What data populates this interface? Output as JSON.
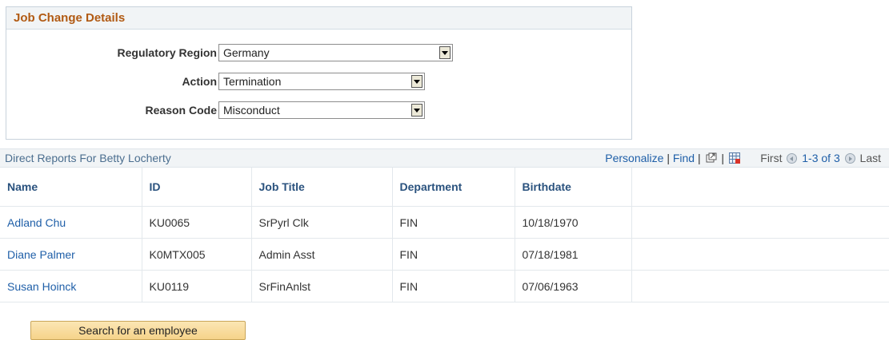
{
  "panel": {
    "title": "Job Change Details",
    "fields": [
      {
        "label": "Regulatory Region",
        "value": "Germany"
      },
      {
        "label": "Action",
        "value": "Termination"
      },
      {
        "label": "Reason Code",
        "value": "Misconduct"
      }
    ]
  },
  "grid": {
    "caption": "Direct Reports For Betty Locherty",
    "personalize": "Personalize",
    "separator": "|",
    "find": "Find",
    "first": "First",
    "range": "1-3 of 3",
    "last": "Last",
    "columns": [
      "Name",
      "ID",
      "Job Title",
      "Department",
      "Birthdate"
    ],
    "rows": [
      {
        "name": "Adland Chu",
        "id": "KU0065",
        "job_title": "SrPyrl Clk",
        "department": "FIN",
        "birthdate": "10/18/1970"
      },
      {
        "name": "Diane Palmer",
        "id": "K0MTX005",
        "job_title": "Admin Asst",
        "department": "FIN",
        "birthdate": "07/18/1981"
      },
      {
        "name": "Susan Hoinck",
        "id": "KU0119",
        "job_title": "SrFinAnlst",
        "department": "FIN",
        "birthdate": "07/06/1963"
      }
    ]
  },
  "search_button": {
    "label": "Search for an employee"
  },
  "icons": {
    "new_window": "new-window-icon",
    "download": "spreadsheet-download-icon",
    "dropdown": "chevron-down-icon",
    "prev": "previous-icon",
    "next": "next-icon"
  }
}
